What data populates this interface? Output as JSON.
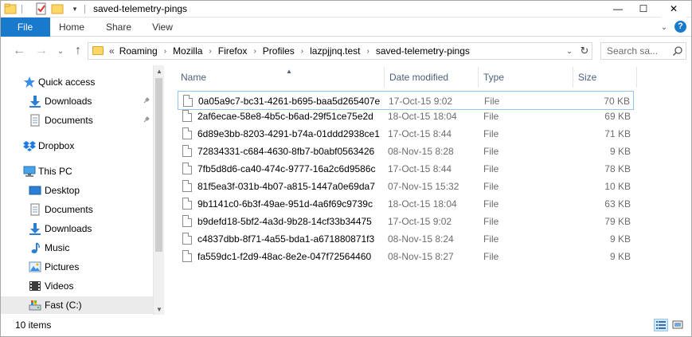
{
  "window": {
    "title": "saved-telemetry-pings",
    "minimize_glyph": "—",
    "maximize_glyph": "☐",
    "close_glyph": "✕"
  },
  "ribbon": {
    "tabs": [
      "File",
      "Home",
      "Share",
      "View"
    ],
    "expand_glyph": "⌄",
    "help_glyph": "?"
  },
  "nav": {
    "back_glyph": "←",
    "forward_glyph": "→",
    "recent_glyph": "⌄",
    "up_glyph": "↑",
    "overflow": "«",
    "breadcrumbs": [
      "Roaming",
      "Mozilla",
      "Firefox",
      "Profiles",
      "lazpjjnq.test",
      "saved-telemetry-pings"
    ],
    "crumb_sep": "›",
    "dropdown_glyph": "⌄",
    "refresh_glyph": "↻",
    "search_placeholder": "Search sa..."
  },
  "sidebar": {
    "items": [
      {
        "label": "Quick access",
        "icon": "star-icon"
      },
      {
        "label": "Downloads",
        "icon": "download-arrow-icon",
        "pinned": true
      },
      {
        "label": "Documents",
        "icon": "document-icon",
        "pinned": true
      },
      {
        "label": "Dropbox",
        "icon": "dropbox-icon"
      },
      {
        "label": "This PC",
        "icon": "computer-icon"
      },
      {
        "label": "Desktop",
        "icon": "desktop-icon"
      },
      {
        "label": "Documents",
        "icon": "document-icon"
      },
      {
        "label": "Downloads",
        "icon": "download-arrow-icon"
      },
      {
        "label": "Music",
        "icon": "music-note-icon"
      },
      {
        "label": "Pictures",
        "icon": "picture-icon"
      },
      {
        "label": "Videos",
        "icon": "video-icon"
      },
      {
        "label": "Fast (C:)",
        "icon": "drive-icon",
        "selected": true
      }
    ],
    "pin_glyph": "📌",
    "scroll_up_glyph": "▲",
    "scroll_down_glyph": "▼"
  },
  "list": {
    "columns": [
      "Name",
      "Date modified",
      "Type",
      "Size"
    ],
    "sort_glyph": "▲",
    "rows": [
      {
        "name": "0a05a9c7-bc31-4261-b695-baa5d265407e",
        "date": "17-Oct-15 9:02",
        "type": "File",
        "size": "70 KB"
      },
      {
        "name": "2af6ecae-58e8-4b5c-b6ad-29f51ce75e2d",
        "date": "18-Oct-15 18:04",
        "type": "File",
        "size": "69 KB"
      },
      {
        "name": "6d89e3bb-8203-4291-b74a-01ddd2938ce1",
        "date": "17-Oct-15 8:44",
        "type": "File",
        "size": "71 KB"
      },
      {
        "name": "72834331-c684-4630-8fb7-b0abf0563426",
        "date": "08-Nov-15 8:28",
        "type": "File",
        "size": "9 KB"
      },
      {
        "name": "7fb5d8d6-ca40-474c-9777-16a2c6d9586c",
        "date": "17-Oct-15 8:44",
        "type": "File",
        "size": "78 KB"
      },
      {
        "name": "81f5ea3f-031b-4b07-a815-1447a0e69da7",
        "date": "07-Nov-15 15:32",
        "type": "File",
        "size": "10 KB"
      },
      {
        "name": "9b1141c0-6b3f-49ae-951d-4a6f69c9739c",
        "date": "18-Oct-15 18:04",
        "type": "File",
        "size": "63 KB"
      },
      {
        "name": "b9defd18-5bf2-4a3d-9b28-14cf33b34475",
        "date": "17-Oct-15 9:02",
        "type": "File",
        "size": "79 KB"
      },
      {
        "name": "c4837dbb-8f71-4a55-bda1-a671880871f3",
        "date": "08-Nov-15 8:24",
        "type": "File",
        "size": "9 KB"
      },
      {
        "name": "fa559dc1-f2d9-48ac-8e2e-047f72564460",
        "date": "08-Nov-15 8:27",
        "type": "File",
        "size": "9 KB"
      }
    ]
  },
  "status": {
    "item_count": "10 items"
  },
  "colors": {
    "accent": "#1979ca",
    "header_text": "#4c607a",
    "folder_yellow": "#ffd766"
  }
}
